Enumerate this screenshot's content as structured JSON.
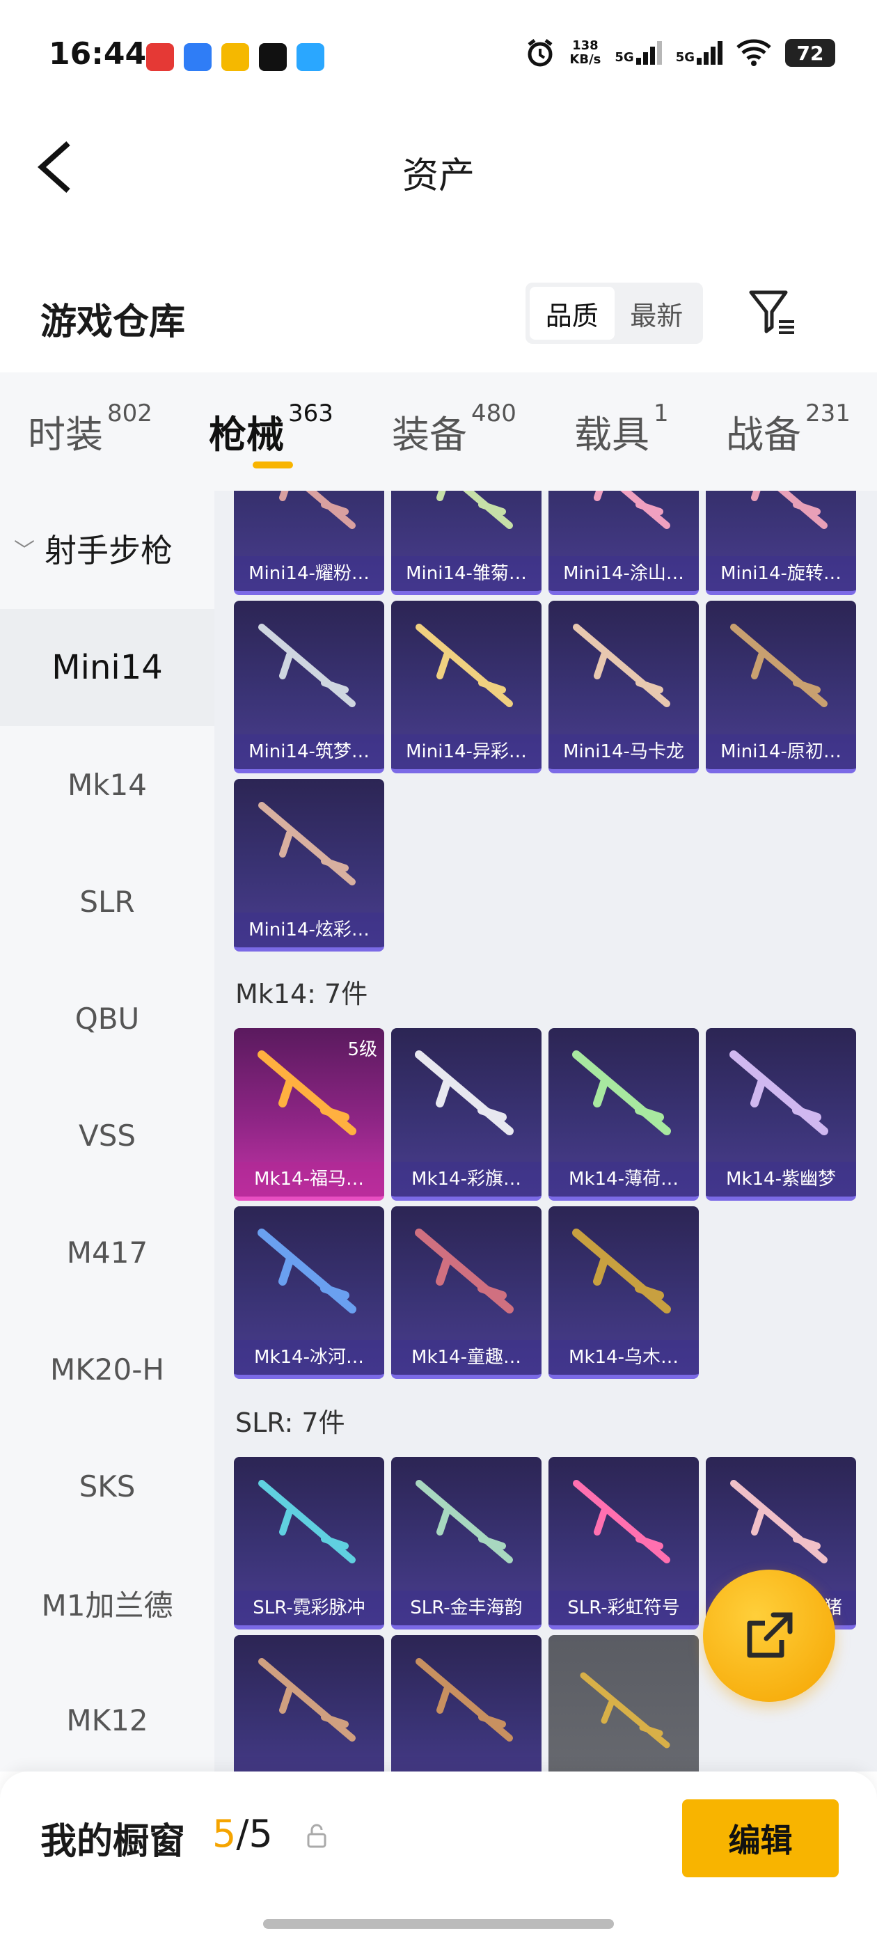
{
  "status": {
    "time": "16:44",
    "speed": "138",
    "speed_unit": "KB/s",
    "net1": "5G",
    "net2": "5G",
    "battery": "72"
  },
  "header": {
    "title": "资产"
  },
  "section": {
    "title": "游戏仓库",
    "sort_options": [
      "品质",
      "最新"
    ],
    "active_sort": "品质"
  },
  "tabs": [
    {
      "label": "时装",
      "count": "802"
    },
    {
      "label": "枪械",
      "count": "363"
    },
    {
      "label": "装备",
      "count": "480"
    },
    {
      "label": "载具",
      "count": "1"
    },
    {
      "label": "战备",
      "count": "231"
    }
  ],
  "sidebar": {
    "category": "射手步枪",
    "items": [
      "Mini14",
      "Mk14",
      "SLR",
      "QBU",
      "VSS",
      "M417",
      "MK20-H",
      "SKS",
      "M1加兰德",
      "MK12"
    ],
    "active": "Mini14"
  },
  "groups": {
    "mk14": "Mk14: 7件",
    "slr": "SLR: 7件"
  },
  "items": {
    "mini14_row1": [
      "Mini14-耀粉…",
      "Mini14-雏菊…",
      "Mini14-涂山…",
      "Mini14-旋转…"
    ],
    "mini14_row2": [
      "Mini14-筑梦…",
      "Mini14-异彩…",
      "Mini14-马卡龙",
      "Mini14-原初…"
    ],
    "mini14_row3": [
      "Mini14-炫彩…"
    ],
    "mk14_row1": [
      "Mk14-福马…",
      "Mk14-彩旗…",
      "Mk14-薄荷…",
      "Mk14-紫幽梦"
    ],
    "mk14_level": "5级",
    "mk14_row2": [
      "Mk14-冰河…",
      "Mk14-童趣…",
      "Mk14-乌木…"
    ],
    "slr_row1": [
      "SLR-霓彩脉冲",
      "SLR-金丰海韵",
      "SLR-彩虹符号",
      "猪"
    ]
  },
  "showcase": {
    "label": "我的橱窗",
    "current": "5",
    "total": "/5",
    "edit_label": "编辑"
  },
  "colors": {
    "accent": "#f8b400",
    "card_purple": "#3a3375",
    "card_pink": "#c334a6"
  }
}
